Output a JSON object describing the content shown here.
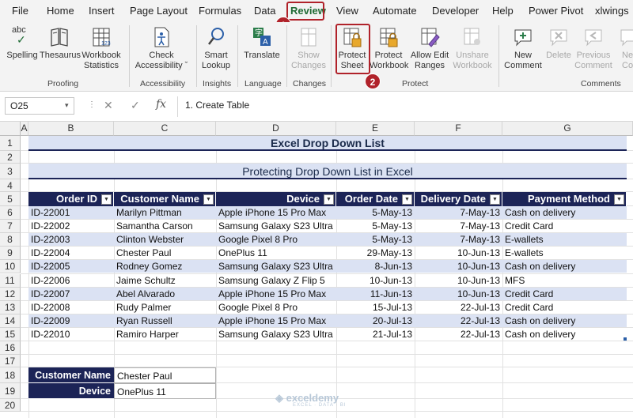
{
  "menu": {
    "tabs": [
      "File",
      "Home",
      "Insert",
      "Page Layout",
      "Formulas",
      "Data",
      "Review",
      "View",
      "Automate",
      "Developer",
      "Help",
      "Power Pivot",
      "xlwings"
    ],
    "active": "Review"
  },
  "ribbon": {
    "groups": {
      "proofing": "Proofing",
      "accessibility": "Accessibility",
      "insights": "Insights",
      "language": "Language",
      "changes": "Changes",
      "protect": "Protect",
      "comments": "Comments"
    },
    "buttons": {
      "spelling": "Spelling",
      "thesaurus": "Thesaurus",
      "workbook_statistics_1": "Workbook",
      "workbook_statistics_2": "Statistics",
      "check_accessibility_1": "Check",
      "check_accessibility_2": "Accessibility ˇ",
      "smart_lookup_1": "Smart",
      "smart_lookup_2": "Lookup",
      "translate": "Translate",
      "show_changes_1": "Show",
      "show_changes_2": "Changes",
      "protect_sheet_1": "Protect",
      "protect_sheet_2": "Sheet",
      "protect_workbook_1": "Protect",
      "protect_workbook_2": "Workbook",
      "allow_edit_ranges_1": "Allow Edit",
      "allow_edit_ranges_2": "Ranges",
      "unshare_workbook_1": "Unshare",
      "unshare_workbook_2": "Workbook",
      "new_comment_1": "New",
      "new_comment_2": "Comment",
      "delete_comment": "Delete",
      "previous_comment_1": "Previous",
      "previous_comment_2": "Comment",
      "next_comment_1": "Ne",
      "next_comment_2": "Co",
      "abc_label": "abc"
    }
  },
  "annotations": {
    "step1": "1",
    "step2": "2"
  },
  "formula_bar": {
    "name_box": "O25",
    "formula": "1. Create Table",
    "cancel_glyph": "✕",
    "enter_glyph": "✓",
    "fx_glyph": "fx"
  },
  "columns": [
    "A",
    "B",
    "C",
    "D",
    "E",
    "F",
    "G"
  ],
  "rows": [
    "1",
    "2",
    "3",
    "4",
    "5",
    "6",
    "7",
    "8",
    "9",
    "10",
    "11",
    "12",
    "13",
    "14",
    "15",
    "16",
    "17",
    "18",
    "19",
    "20"
  ],
  "sheet": {
    "title": "Excel Drop Down List",
    "subtitle": "Protecting Drop Down List in Excel",
    "headers": [
      "Order ID",
      "Customer Name",
      "Device",
      "Order Date",
      "Delivery Date",
      "Payment Method"
    ],
    "filter_glyph": "▼",
    "table": [
      [
        "ID-22001",
        "Marilyn Pittman",
        "Apple iPhone 15 Pro Max",
        "5-May-13",
        "7-May-13",
        "Cash on delivery"
      ],
      [
        "ID-22002",
        "Samantha Carson",
        "Samsung Galaxy S23 Ultra",
        "5-May-13",
        "7-May-13",
        "Credit Card"
      ],
      [
        "ID-22003",
        "Clinton Webster",
        "Google Pixel 8 Pro",
        "5-May-13",
        "7-May-13",
        "E-wallets"
      ],
      [
        "ID-22004",
        "Chester Paul",
        "OnePlus 11",
        "29-May-13",
        "10-Jun-13",
        "E-wallets"
      ],
      [
        "ID-22005",
        "Rodney Gomez",
        "Samsung Galaxy S23 Ultra",
        "8-Jun-13",
        "10-Jun-13",
        "Cash on delivery"
      ],
      [
        "ID-22006",
        "Jaime Schultz",
        "Samsung Galaxy Z Flip 5",
        "10-Jun-13",
        "10-Jun-13",
        "MFS"
      ],
      [
        "ID-22007",
        "Abel Alvarado",
        "Apple iPhone 15 Pro Max",
        "11-Jun-13",
        "10-Jun-13",
        "Credit Card"
      ],
      [
        "ID-22008",
        "Rudy Palmer",
        "Google Pixel 8 Pro",
        "15-Jul-13",
        "22-Jul-13",
        "Credit Card"
      ],
      [
        "ID-22009",
        "Ryan Russell",
        "Apple iPhone 15 Pro Max",
        "20-Jul-13",
        "22-Jul-13",
        "Cash on delivery"
      ],
      [
        "ID-22010",
        "Ramiro Harper",
        "Samsung Galaxy S23 Ultra",
        "21-Jul-13",
        "22-Jul-13",
        "Cash on delivery"
      ]
    ],
    "lookup": [
      {
        "label": "Customer Name",
        "value": "Chester Paul"
      },
      {
        "label": "Device",
        "value": "OnePlus 11"
      }
    ]
  },
  "watermark": {
    "name": "exceldemy",
    "tagline": "EXCEL · DATA · BI"
  },
  "colors": {
    "header_bg": "#1c2457",
    "title_bg": "#dbe2f3",
    "band_bg": "#dbe2f3",
    "annotation": "#b0222a"
  }
}
